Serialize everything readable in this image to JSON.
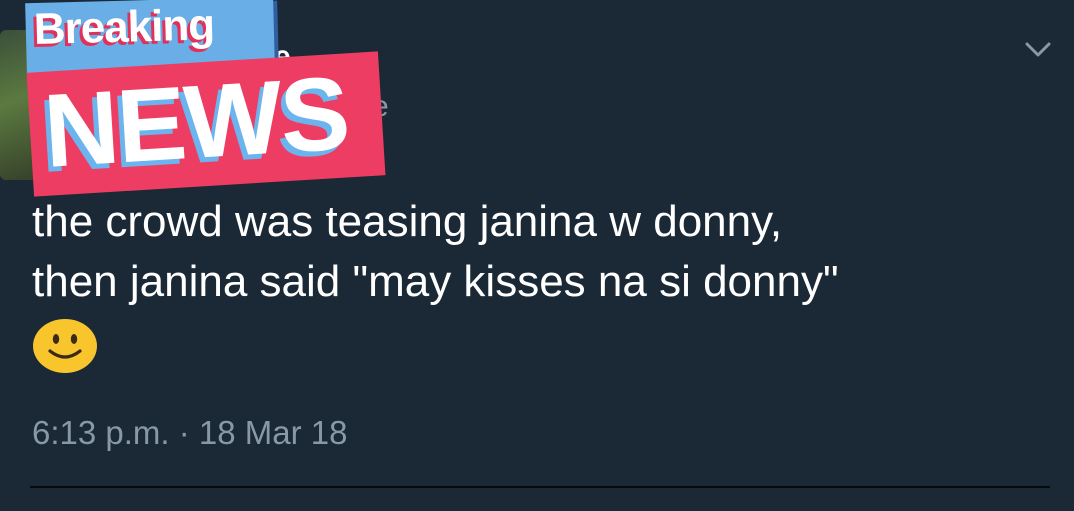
{
  "header": {
    "display_name_fragment": "snyne",
    "handle_fragment": "e"
  },
  "stickers": {
    "breaking": "Breaking",
    "news": "NEWS"
  },
  "tweet": {
    "lines": [
      "the crowd was teasing janina w donny,",
      "then janina said \"may kisses na si donny\""
    ],
    "emoji_icon": "slightly-smiling-face-icon",
    "timestamp": "6:13 p.m. · 18 Mar 18"
  },
  "colors": {
    "background": "#1b2836",
    "text": "#ffffff",
    "muted": "#8899a6",
    "sticker_red": "#ee3d62",
    "sticker_blue": "#6aaee8"
  }
}
